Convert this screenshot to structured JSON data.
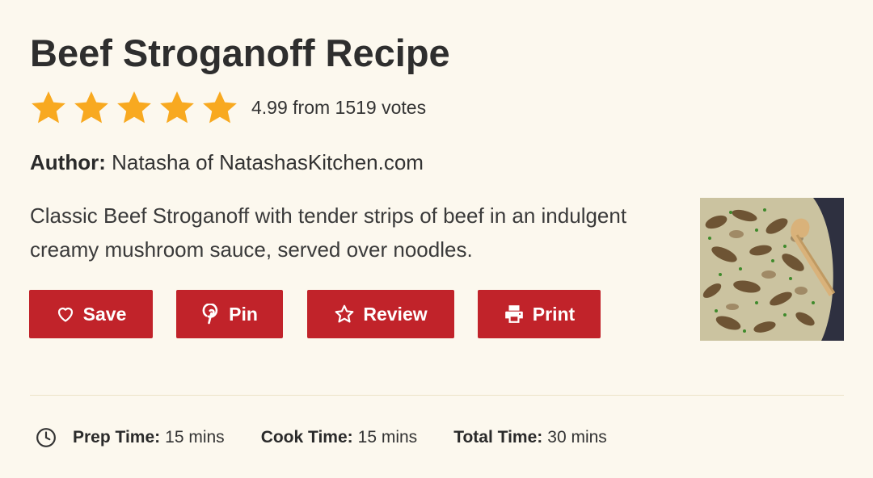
{
  "recipe": {
    "title": "Beef Stroganoff Recipe",
    "rating": {
      "stars": 5,
      "score_text": "4.99 from 1519 votes",
      "star_color": "#f8a920"
    },
    "author": {
      "label": "Author:",
      "name": "Natasha of NatashasKitchen.com"
    },
    "summary": "Classic Beef Stroganoff with tender strips of beef in an indulgent creamy mushroom sauce, served over noodles.",
    "buttons": {
      "save": {
        "label": "Save",
        "icon": "heart-icon"
      },
      "pin": {
        "label": "Pin",
        "icon": "pinterest-icon"
      },
      "review": {
        "label": "Review",
        "icon": "star-outline-icon"
      },
      "print": {
        "label": "Print",
        "icon": "printer-icon"
      }
    },
    "button_color": "#c1232a",
    "times": {
      "prep": {
        "label": "Prep Time:",
        "value": "15 mins"
      },
      "cook": {
        "label": "Cook Time:",
        "value": "15 mins"
      },
      "total": {
        "label": "Total Time:",
        "value": "30 mins"
      }
    }
  }
}
